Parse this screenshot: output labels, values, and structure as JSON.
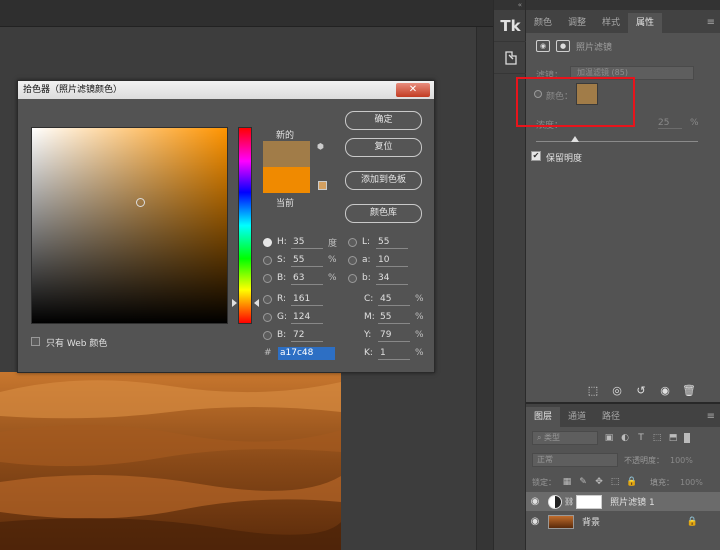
{
  "strip": {
    "tk_label": "Tk",
    "top_arrows": "«"
  },
  "panel": {
    "tabs": [
      "颜色",
      "调整",
      "样式",
      "属性"
    ],
    "title": "照片滤镜",
    "filter_label": "滤镜：",
    "filter_value": "加温滤镜 (85)",
    "color_label": "颜色：",
    "density_label": "浓度：",
    "density_value": "25",
    "density_unit": "%",
    "preserve_label": "保留明度",
    "menu_icon": "≡"
  },
  "layers": {
    "tabs": [
      "图层",
      "通道",
      "路径"
    ],
    "kind_label": "类型",
    "blend_mode": "正常",
    "opacity_label": "不透明度：",
    "opacity_value": "100%",
    "lock_label": "锁定：",
    "fill_label": "填充：",
    "fill_value": "100%",
    "rows": [
      {
        "name": "照片滤镜 1"
      },
      {
        "name": "背景"
      }
    ]
  },
  "dialog": {
    "title": "拾色器（照片滤镜颜色）",
    "close_glyph": "✕",
    "new_label": "新的",
    "current_label": "当前",
    "buttons": [
      "确定",
      "复位",
      "添加到色板",
      "颜色库"
    ],
    "web_label": "只有 Web 颜色",
    "hex_prefix": "#",
    "hex_value": "a17c48",
    "new_color": "#a17c48",
    "current_color": "#f08a00",
    "fields_left": [
      {
        "label": "H:",
        "value": "35",
        "unit": "度",
        "on": true
      },
      {
        "label": "S:",
        "value": "55",
        "unit": "%",
        "on": false
      },
      {
        "label": "B:",
        "value": "63",
        "unit": "%",
        "on": false
      },
      {
        "label": "R:",
        "value": "161",
        "unit": "",
        "on": false
      },
      {
        "label": "G:",
        "value": "124",
        "unit": "",
        "on": false
      },
      {
        "label": "B:",
        "value": "72",
        "unit": "",
        "on": false
      }
    ],
    "fields_lab": [
      {
        "label": "L:",
        "value": "55"
      },
      {
        "label": "a:",
        "value": "10"
      },
      {
        "label": "b:",
        "value": "34"
      }
    ],
    "fields_cmyk": [
      {
        "label": "C:",
        "value": "45",
        "unit": "%"
      },
      {
        "label": "M:",
        "value": "55",
        "unit": "%"
      },
      {
        "label": "Y:",
        "value": "79",
        "unit": "%"
      },
      {
        "label": "K:",
        "value": "1",
        "unit": "%"
      }
    ]
  }
}
